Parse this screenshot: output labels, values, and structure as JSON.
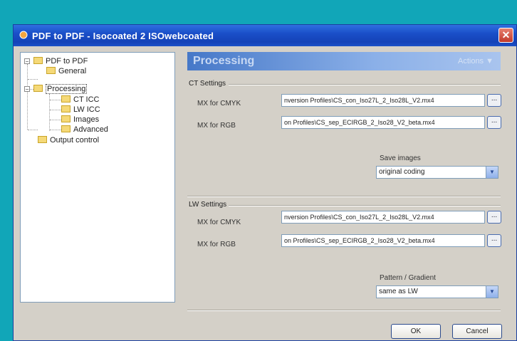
{
  "window": {
    "title": "PDF to PDF - Isocoated 2 ISOwebcoated",
    "close_glyph": "✕"
  },
  "tree": {
    "root": "PDF to PDF",
    "general": "General",
    "processing": "Processing",
    "ct_icc": "CT ICC",
    "lw_icc": "LW ICC",
    "images": "Images",
    "advanced": "Advanced",
    "output_control": "Output control",
    "collapse_glyph": "−"
  },
  "header": {
    "title": "Processing",
    "actions": "Actions ▼"
  },
  "ct_settings": {
    "label": "CT Settings",
    "cmyk_label": "MX for CMYK",
    "cmyk_value": "nversion Profiles\\CS_con_Iso27L_2_Iso28L_V2.mx4",
    "rgb_label": "MX for RGB",
    "rgb_value": "on Profiles\\CS_sep_ECIRGB_2_Iso28_V2_beta.mx4",
    "browse_label": "...",
    "save_images_label": "Save images",
    "save_images_value": "original coding"
  },
  "lw_settings": {
    "label": "LW Settings",
    "cmyk_label": "MX for CMYK",
    "cmyk_value": "nversion Profiles\\CS_con_Iso27L_2_Iso28L_V2.mx4",
    "rgb_label": "MX for RGB",
    "rgb_value": "on Profiles\\CS_sep_ECIRGB_2_Iso28_V2_beta.mx4",
    "browse_label": "...",
    "pattern_label": "Pattern / Gradient",
    "pattern_value": "same as LW"
  },
  "buttons": {
    "ok": "OK",
    "cancel": "Cancel"
  },
  "icons": {
    "app": "pdf-app-icon",
    "folder": "folder-icon",
    "dropdown": "chevron-down-icon"
  },
  "colors": {
    "desktop": "#11a6b8",
    "titlebar": "#1a4fc8",
    "header_band": "#4678c8",
    "close": "#c0392b"
  }
}
